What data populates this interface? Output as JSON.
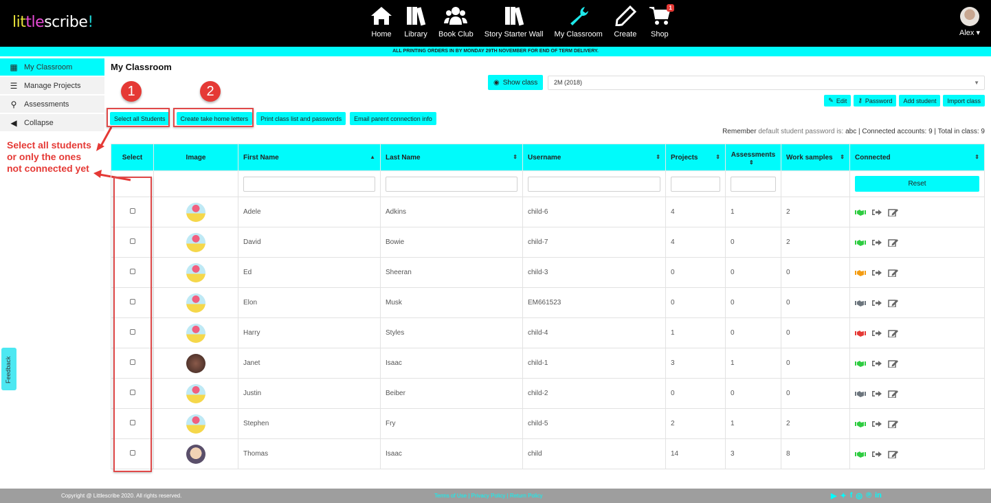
{
  "brand": {
    "logo_parts": [
      "lit",
      "tle",
      "scribe",
      "!"
    ]
  },
  "nav": [
    {
      "label": "Home",
      "icon": "home-icon"
    },
    {
      "label": "Library",
      "icon": "books-icon"
    },
    {
      "label": "Book Club",
      "icon": "users-icon"
    },
    {
      "label": "Story Starter Wall",
      "icon": "books-icon"
    },
    {
      "label": "My Classroom",
      "icon": "wrench-icon",
      "active": true
    },
    {
      "label": "Create",
      "icon": "pencil-icon"
    },
    {
      "label": "Shop",
      "icon": "cart-icon",
      "badge": "1"
    }
  ],
  "user": {
    "name": "Alex"
  },
  "announcement": "ALL PRINTING ORDERS IN BY MONDAY 29TH NOVEMBER FOR END OF TERM DELIVERY.",
  "sidebar": {
    "items": [
      {
        "label": "My Classroom",
        "icon": "classroom-icon",
        "active": true
      },
      {
        "label": "Manage Projects",
        "icon": "list-icon"
      },
      {
        "label": "Assessments",
        "icon": "binoculars-icon"
      },
      {
        "label": "Collapse",
        "icon": "chevron-left-circle-icon"
      }
    ]
  },
  "annotations": {
    "marker1": "1",
    "marker2": "2",
    "note_lines": [
      "Select all students",
      "or only the ones",
      "not connected yet"
    ]
  },
  "page_title": "My Classroom",
  "class_selector": {
    "show_label": "Show class",
    "selected": "2M (2018)"
  },
  "class_buttons": {
    "edit": "Edit",
    "password": "Password",
    "add_student": "Add student",
    "import_class": "Import class"
  },
  "actions": {
    "select_all": "Select all Students",
    "take_home": "Create take home letters",
    "print_list": "Print class list and passwords",
    "email_parent": "Email parent connection info"
  },
  "info": {
    "remember": "Remember",
    "default_pw_label": "default student password is:",
    "default_pw": "abc",
    "connected_label": "| Connected accounts: 9 | Total in class: 9"
  },
  "table": {
    "headers": [
      "Select",
      "Image",
      "First Name",
      "Last Name",
      "Username",
      "Projects",
      "Assessments",
      "Work samples",
      "Connected"
    ],
    "reset_label": "Reset",
    "status_colors": {
      "connected": "#2ecc40",
      "pending": "#f39c12",
      "none": "#6c757d",
      "error": "#e53935"
    },
    "rows": [
      {
        "first": "Adele",
        "last": "Adkins",
        "username": "child-6",
        "projects": "4",
        "assessments": "1",
        "work_samples": "2",
        "avatar": "cartoon",
        "status": "connected"
      },
      {
        "first": "David",
        "last": "Bowie",
        "username": "child-7",
        "projects": "4",
        "assessments": "0",
        "work_samples": "2",
        "avatar": "cartoon",
        "status": "connected"
      },
      {
        "first": "Ed",
        "last": "Sheeran",
        "username": "child-3",
        "projects": "0",
        "assessments": "0",
        "work_samples": "0",
        "avatar": "cartoon",
        "status": "pending"
      },
      {
        "first": "Elon",
        "last": "Musk",
        "username": "EM661523",
        "projects": "0",
        "assessments": "0",
        "work_samples": "0",
        "avatar": "cartoon",
        "status": "none"
      },
      {
        "first": "Harry",
        "last": "Styles",
        "username": "child-4",
        "projects": "1",
        "assessments": "0",
        "work_samples": "0",
        "avatar": "cartoon",
        "status": "error"
      },
      {
        "first": "Janet",
        "last": "Isaac",
        "username": "child-1",
        "projects": "3",
        "assessments": "1",
        "work_samples": "0",
        "avatar": "photo1",
        "status": "connected"
      },
      {
        "first": "Justin",
        "last": "Beiber",
        "username": "child-2",
        "projects": "0",
        "assessments": "0",
        "work_samples": "0",
        "avatar": "cartoon",
        "status": "none"
      },
      {
        "first": "Stephen",
        "last": "Fry",
        "username": "child-5",
        "projects": "2",
        "assessments": "1",
        "work_samples": "2",
        "avatar": "cartoon",
        "status": "connected"
      },
      {
        "first": "Thomas",
        "last": "Isaac",
        "username": "child",
        "projects": "14",
        "assessments": "3",
        "work_samples": "8",
        "avatar": "photo2",
        "status": "connected"
      }
    ]
  },
  "footer": {
    "copyright": "Copyright @ Littlescribe 2020. All rights reserved.",
    "links": "Terms of Use  |  Privacy Policy  |  Return Policy",
    "social": [
      "youtube-icon",
      "twitter-icon",
      "facebook-icon",
      "instagram-icon",
      "pinterest-icon",
      "linkedin-icon"
    ]
  },
  "feedback_label": "Feedback"
}
